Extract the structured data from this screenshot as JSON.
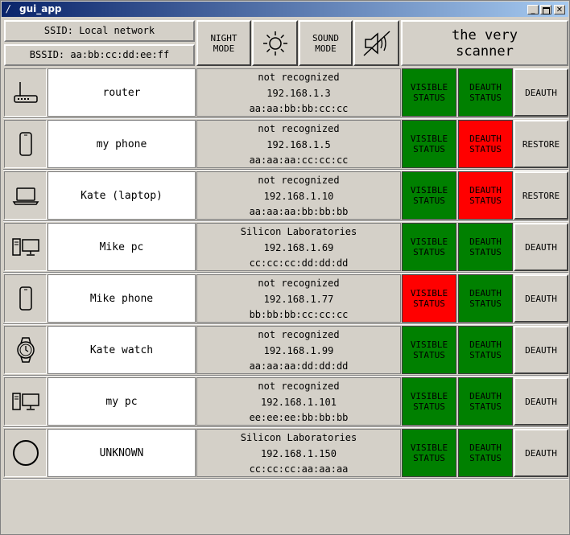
{
  "window": {
    "title": "gui_app",
    "app_icon": "/"
  },
  "header": {
    "ssid": "SSID: Local network",
    "bssid": "BSSID: aa:bb:cc:dd:ee:ff",
    "night_mode": [
      "NIGHT",
      "MODE"
    ],
    "sound_mode": [
      "SOUND",
      "MODE"
    ],
    "app_title": [
      "the very",
      "scanner"
    ]
  },
  "status_labels": {
    "visible": [
      "VISIBLE",
      "STATUS"
    ],
    "deauth": [
      "DEAUTH",
      "STATUS"
    ]
  },
  "colors": {
    "ok": "#008000",
    "bad": "#ff0000",
    "title_start": "#0a246a",
    "title_end": "#a6caf0"
  },
  "devices": [
    {
      "icon": "router-icon",
      "name": "router",
      "vendor": "not recognized",
      "ip": "192.168.1.3",
      "mac": "aa:aa:bb:bb:cc:cc",
      "visible": "ok",
      "deauth": "ok",
      "action": "DEAUTH"
    },
    {
      "icon": "phone-icon",
      "name": "my phone",
      "vendor": "not recognized",
      "ip": "192.168.1.5",
      "mac": "aa:aa:aa:cc:cc:cc",
      "visible": "ok",
      "deauth": "bad",
      "action": "RESTORE"
    },
    {
      "icon": "laptop-icon",
      "name": "Kate (laptop)",
      "vendor": "not recognized",
      "ip": "192.168.1.10",
      "mac": "aa:aa:aa:bb:bb:bb",
      "visible": "ok",
      "deauth": "bad",
      "action": "RESTORE"
    },
    {
      "icon": "desktop-pc-icon",
      "name": "Mike pc",
      "vendor": "Silicon Laboratories",
      "ip": "192.168.1.69",
      "mac": "cc:cc:cc:dd:dd:dd",
      "visible": "ok",
      "deauth": "ok",
      "action": "DEAUTH"
    },
    {
      "icon": "phone-icon",
      "name": "Mike phone",
      "vendor": "not recognized",
      "ip": "192.168.1.77",
      "mac": "bb:bb:bb:cc:cc:cc",
      "visible": "bad",
      "deauth": "ok",
      "action": "DEAUTH"
    },
    {
      "icon": "watch-icon",
      "name": "Kate watch",
      "vendor": "not recognized",
      "ip": "192.168.1.99",
      "mac": "aa:aa:aa:dd:dd:dd",
      "visible": "ok",
      "deauth": "ok",
      "action": "DEAUTH"
    },
    {
      "icon": "desktop-pc-icon",
      "name": "my pc",
      "vendor": "not recognized",
      "ip": "192.168.1.101",
      "mac": "ee:ee:ee:bb:bb:bb",
      "visible": "ok",
      "deauth": "ok",
      "action": "DEAUTH"
    },
    {
      "icon": "unknown-device-icon",
      "name": "UNKNOWN",
      "vendor": "Silicon Laboratories",
      "ip": "192.168.1.150",
      "mac": "cc:cc:cc:aa:aa:aa",
      "visible": "ok",
      "deauth": "ok",
      "action": "DEAUTH"
    }
  ]
}
